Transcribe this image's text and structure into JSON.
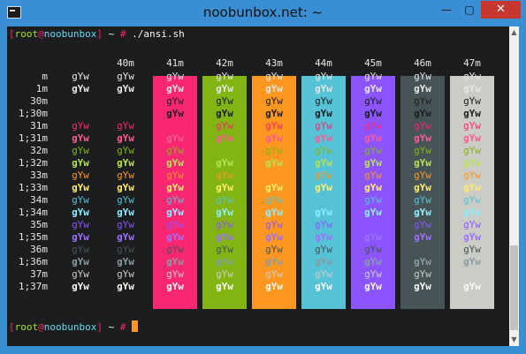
{
  "window": {
    "title": "noobunbox.net: ~",
    "minimize_glyph": "—",
    "maximize_glyph": "▢",
    "close_glyph": "✕"
  },
  "terminal": {
    "prompt1": {
      "bracket_open": "[",
      "user": "root",
      "at": "@",
      "host": "noobunbox",
      "bracket_close": "]",
      "path": " ~ ",
      "symbol": "#",
      "command": " ./ansi.sh"
    },
    "prompt2": {
      "bracket_open": "[",
      "user": "root",
      "at": "@",
      "host": "noobunbox",
      "bracket_close": "]",
      "path": " ~ ",
      "symbol": "#"
    },
    "cell_text": "gYw",
    "bg_headers": [
      "40m",
      "41m",
      "42m",
      "43m",
      "44m",
      "45m",
      "46m",
      "47m"
    ],
    "bg_colors": [
      "",
      "#f92672",
      "#82b414",
      "#fd971f",
      "#56c2d6",
      "#8c54fe",
      "#465457",
      "#ccccc6"
    ],
    "rows": [
      {
        "label": "m",
        "fg": "#e6e6e6",
        "bold": false
      },
      {
        "label": "1m",
        "fg": "#e6e6e6",
        "bold": true
      },
      {
        "label": "30m",
        "fg": "#1b1d1e",
        "bold": false
      },
      {
        "label": "1;30m",
        "fg": "#1b1d1e",
        "bold": true
      },
      {
        "label": "31m",
        "fg": "#f92672",
        "bold": false
      },
      {
        "label": "1;31m",
        "fg": "#ff5995",
        "bold": true
      },
      {
        "label": "32m",
        "fg": "#82b414",
        "bold": false
      },
      {
        "label": "1;32m",
        "fg": "#b6e354",
        "bold": true
      },
      {
        "label": "33m",
        "fg": "#fd971f",
        "bold": false
      },
      {
        "label": "1;33m",
        "fg": "#feed6c",
        "bold": true
      },
      {
        "label": "34m",
        "fg": "#56c2d6",
        "bold": false
      },
      {
        "label": "1;34m",
        "fg": "#8cedff",
        "bold": true
      },
      {
        "label": "35m",
        "fg": "#8c54fe",
        "bold": false
      },
      {
        "label": "1;35m",
        "fg": "#9e6ffe",
        "bold": true
      },
      {
        "label": "36m",
        "fg": "#465457",
        "bold": false
      },
      {
        "label": "1;36m",
        "fg": "#899ca1",
        "bold": true
      },
      {
        "label": "37m",
        "fg": "#ccccc6",
        "bold": false
      },
      {
        "label": "1;37m",
        "fg": "#f8f8f2",
        "bold": true
      }
    ],
    "colors": {
      "background": "#1b1d1e",
      "prompt_bracket": "#f92672",
      "prompt_user": "#a6e22e",
      "prompt_host": "#66d9ef",
      "cursor": "#fd971f",
      "titlebar": "#3a8fd4",
      "close_button": "#c7372f"
    }
  }
}
